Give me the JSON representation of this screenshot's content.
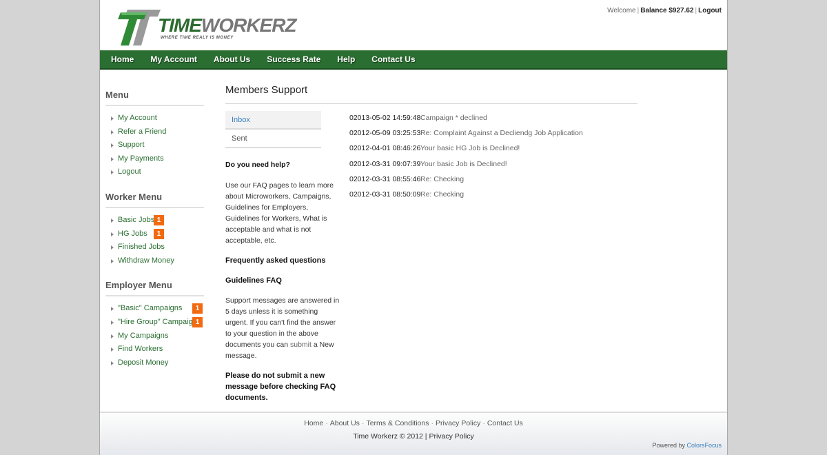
{
  "brand": {
    "name_part1": "TIME",
    "name_part2": "WORKERZ",
    "tagline": "WHERE TIME REALY IS MONEY",
    "primary_color": "#2a6e31",
    "badge_color": "#f26a10"
  },
  "toplinks": {
    "welcome": "Welcome",
    "balance": "Balance $927.62",
    "logout": "Logout"
  },
  "nav": [
    "Home",
    "My Account",
    "About Us",
    "Success Rate",
    "Help",
    "Contact Us"
  ],
  "sidebar": {
    "menu": {
      "title": "Menu",
      "items": [
        {
          "label": "My Account"
        },
        {
          "label": "Refer a Friend"
        },
        {
          "label": "Support"
        },
        {
          "label": "My Payments"
        },
        {
          "label": "Logout"
        }
      ]
    },
    "worker_menu": {
      "title": "Worker Menu",
      "items": [
        {
          "label": "Basic Jobs",
          "badge": "1"
        },
        {
          "label": "HG Jobs",
          "badge": "1"
        },
        {
          "label": "Finished Jobs"
        },
        {
          "label": "Withdraw Money"
        }
      ]
    },
    "employer_menu": {
      "title": "Employer Menu",
      "items": [
        {
          "label": "\"Basic\" Campaigns",
          "badge": "1"
        },
        {
          "label": "\"Hire Group\" Campaigns",
          "badge": "1"
        },
        {
          "label": "My Campaigns"
        },
        {
          "label": "Find Workers"
        },
        {
          "label": "Deposit Money"
        }
      ]
    }
  },
  "main": {
    "title": "Members Support",
    "tabs": [
      {
        "label": "Inbox",
        "active": true
      },
      {
        "label": "Sent",
        "active": false
      }
    ],
    "help": {
      "heading": "Do you need help?",
      "intro": "Use our FAQ pages to learn more about Microworkers, Campaigns, Guidelines for Employers, Guidelines for Workers, What is acceptable and what is not acceptable, etc.",
      "faq_link": "Frequently asked questions",
      "guidelines_link": "Guidelines FAQ",
      "support_text_1": "Support messages are answered in 5 days unless it is something urgent. If you can't find the answer to your question in the above documents you can",
      "submit_link": "submit",
      "support_text_2": "a New message.",
      "warning": "Please do not submit a new message before checking FAQ documents."
    },
    "messages": [
      {
        "date": "02013-05-02 14:59:48",
        "subject": "Campaign * declined"
      },
      {
        "date": "02012-05-09 03:25:53",
        "subject": "Re: Complaint Against a Decliendg Job Application"
      },
      {
        "date": "02012-04-01 08:46:26",
        "subject": "Your basic HG Job is Declined!"
      },
      {
        "date": "02012-03-31 09:07:39",
        "subject": "Your basic Job is Declined!"
      },
      {
        "date": "02012-03-31 08:55:46",
        "subject": "Re: Checking"
      },
      {
        "date": "02012-03-31 08:50:09",
        "subject": "Re: Checking"
      }
    ]
  },
  "footer": {
    "links": [
      "Home",
      "About Us",
      "Terms & Conditions",
      "Privacy Policy",
      "Contact Us"
    ],
    "separator": "·",
    "copyright": "Time Workerz © 2012",
    "copyright_sep": "|",
    "privacy": "Privacy Policy",
    "powered_by": "Powered by",
    "powered_name": "ColorsFocus"
  }
}
